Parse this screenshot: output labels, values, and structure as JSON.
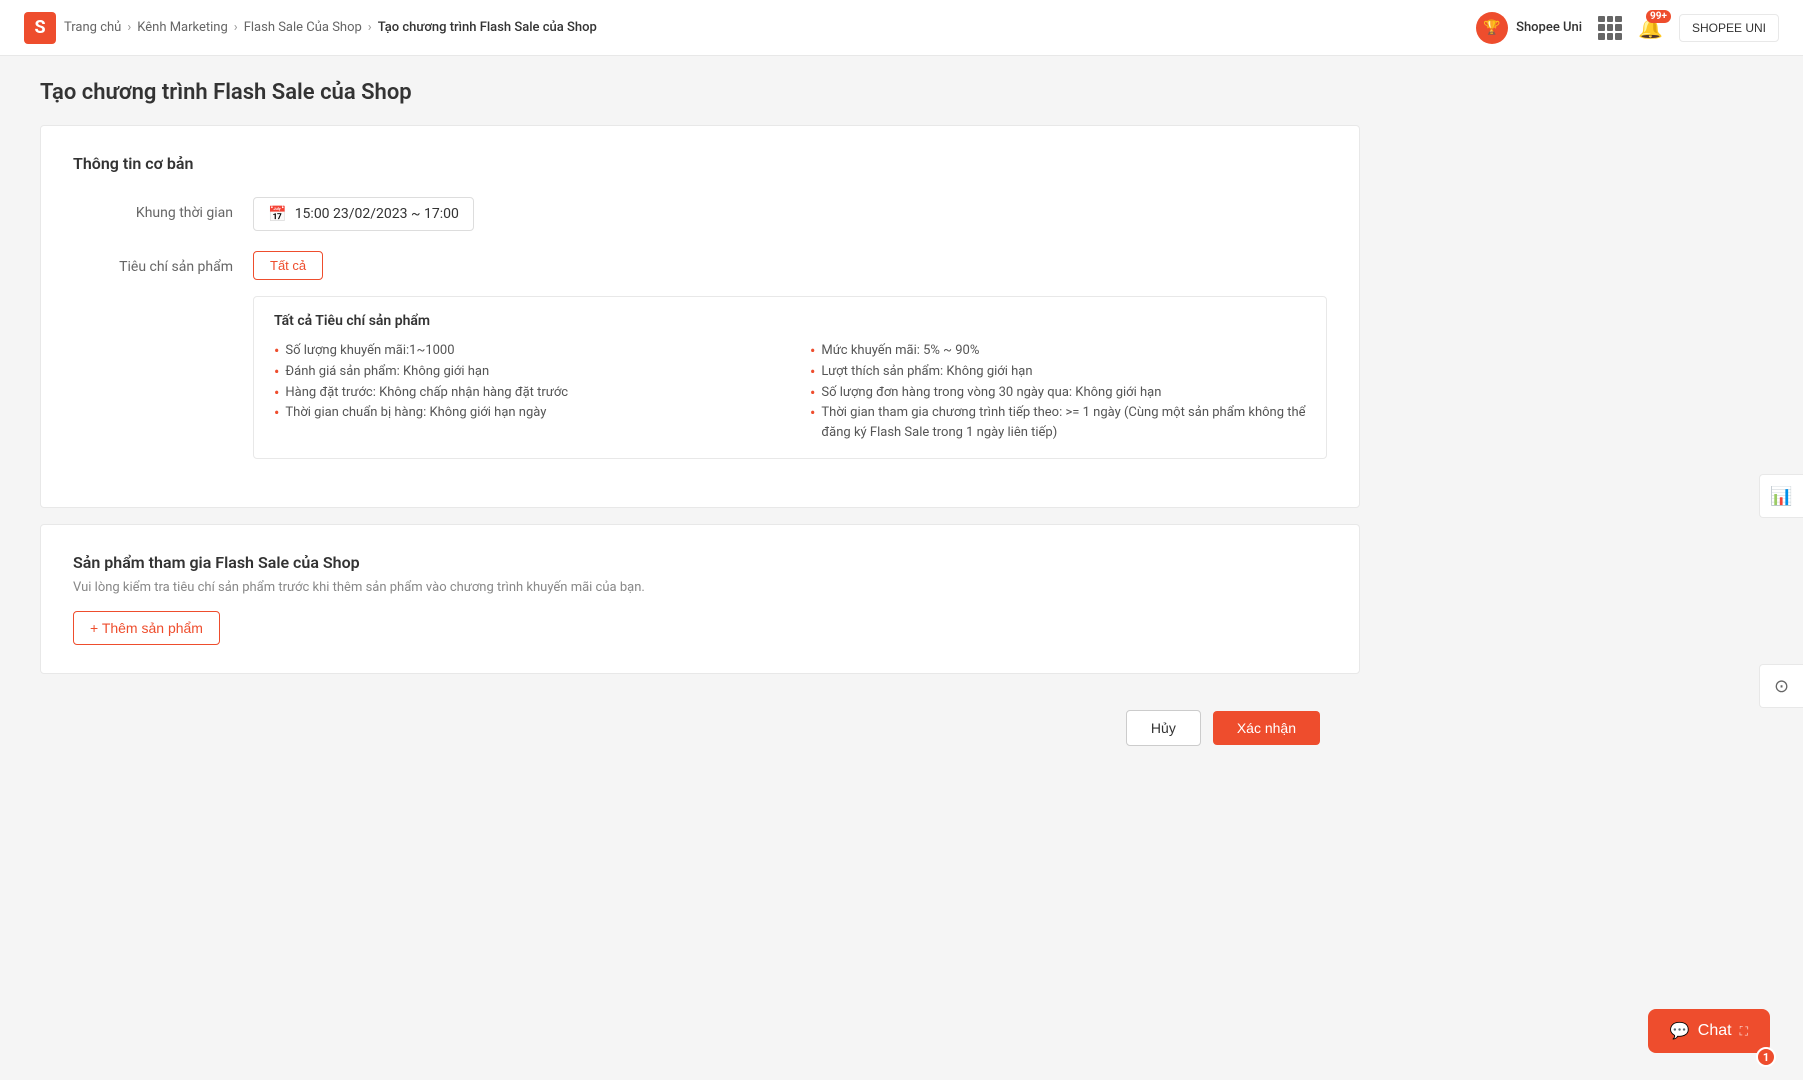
{
  "header": {
    "logo_letter": "S",
    "breadcrumbs": [
      {
        "label": "Trang chủ",
        "href": "#"
      },
      {
        "label": "Kênh Marketing",
        "href": "#"
      },
      {
        "label": "Flash Sale Của Shop",
        "href": "#"
      },
      {
        "label": "Tạo chương trình Flash Sale của Shop",
        "current": true
      }
    ],
    "shopee_uni_label": "Shopee Uni",
    "grid_icon": "grid-icon",
    "notif_badge": "99+",
    "user_label": "SHOPEE UNI"
  },
  "page": {
    "title": "Tạo chương trình Flash Sale của Shop"
  },
  "basic_info": {
    "card_title": "Thông tin cơ bản",
    "time_label": "Khung thời gian",
    "time_value": "15:00 23/02/2023 ~ 17:00",
    "criteria_label": "Tiêu chí sản phẩm",
    "criteria_btn": "Tất cả",
    "criteria_box_title": "Tất cả Tiêu chí sản phẩm",
    "criteria_items": [
      {
        "col": 0,
        "text": "Số lượng khuyến mãi:1~1000"
      },
      {
        "col": 1,
        "text": "Mức khuyến mãi: 5% ~ 90%"
      },
      {
        "col": 0,
        "text": "Đánh giá sản phẩm: Không giới hạn"
      },
      {
        "col": 1,
        "text": "Lượt thích sản phẩm: Không giới hạn"
      },
      {
        "col": 0,
        "text": "Hàng đặt trước: Không chấp nhận hàng đặt trước"
      },
      {
        "col": 1,
        "text": "Số lượng đơn hàng trong vòng 30 ngày qua: Không giới hạn"
      },
      {
        "col": 0,
        "text": "Thời gian chuẩn bị hàng: Không giới hạn ngày"
      },
      {
        "col": 1,
        "text": "Thời gian tham gia chương trình tiếp theo: >= 1 ngày (Cùng một sản phẩm không thể đăng ký Flash Sale trong 1 ngày liên tiếp)"
      }
    ]
  },
  "products": {
    "card_title": "Sản phẩm tham gia Flash Sale của Shop",
    "subtitle": "Vui lòng kiểm tra tiêu chí sản phẩm trước khi thêm sản phẩm vào chương trình khuyến mãi của bạn.",
    "add_btn": "+ Thêm sản phẩm"
  },
  "actions": {
    "cancel_label": "Hủy",
    "confirm_label": "Xác nhận"
  },
  "chat": {
    "label": "Chat",
    "badge": "1"
  }
}
